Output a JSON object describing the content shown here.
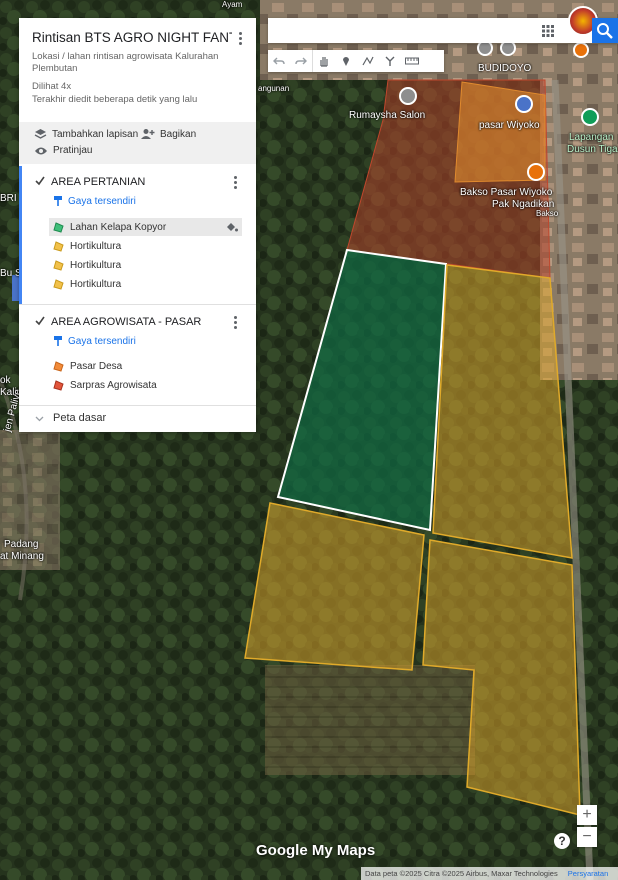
{
  "map": {
    "poi_labels": [
      "Rumaysha Salon",
      "pasar Wiyoko",
      "Bakso Pasar Wiyoko",
      "Pak Ngadikan",
      "Bakso",
      "BUDIDOYO",
      "Lapangan",
      "Dusun Tiga",
      "Bu S",
      "BRI",
      "Ayam",
      "angunan",
      "Padang",
      "at Minang",
      "ok",
      "Kali",
      "jen Palive"
    ],
    "footer_text": "Data peta ©2025 Citra ©2025 Airbus, Maxar Technologies",
    "terms": "Persyaratan",
    "logo": "Google My Maps",
    "zoom_in": "+",
    "zoom_out": "−",
    "help": "?"
  },
  "panel": {
    "title": "Rintisan BTS AGRO NIGHT FANTA...",
    "description": "Lokasi / lahan rintisan agrowisata Kalurahan Plembutan",
    "views": "Dilihat 4x",
    "edited": "Terakhir diedit beberapa detik yang lalu",
    "add_layer": "Tambahkan lapisan",
    "share": "Bagikan",
    "preview": "Pratinjau",
    "base_map": "Peta dasar",
    "layers": [
      {
        "name": "AREA PERTANIAN",
        "style": "Gaya tersendiri",
        "items": [
          "Lahan Kelapa Kopyor",
          "Hortikultura",
          "Hortikultura",
          "Hortikultura"
        ]
      },
      {
        "name": "AREA AGROWISATA - PASAR",
        "style": "Gaya tersendiri",
        "items": [
          "Pasar Desa",
          "Sarpras Agrowisata"
        ]
      }
    ]
  },
  "colors": {
    "green_area": "#0f6b45",
    "yellow_area": "#d7a32b",
    "red_area": "#b5442c",
    "orange_area": "#e08a2e",
    "accent": "#1a73e8"
  }
}
